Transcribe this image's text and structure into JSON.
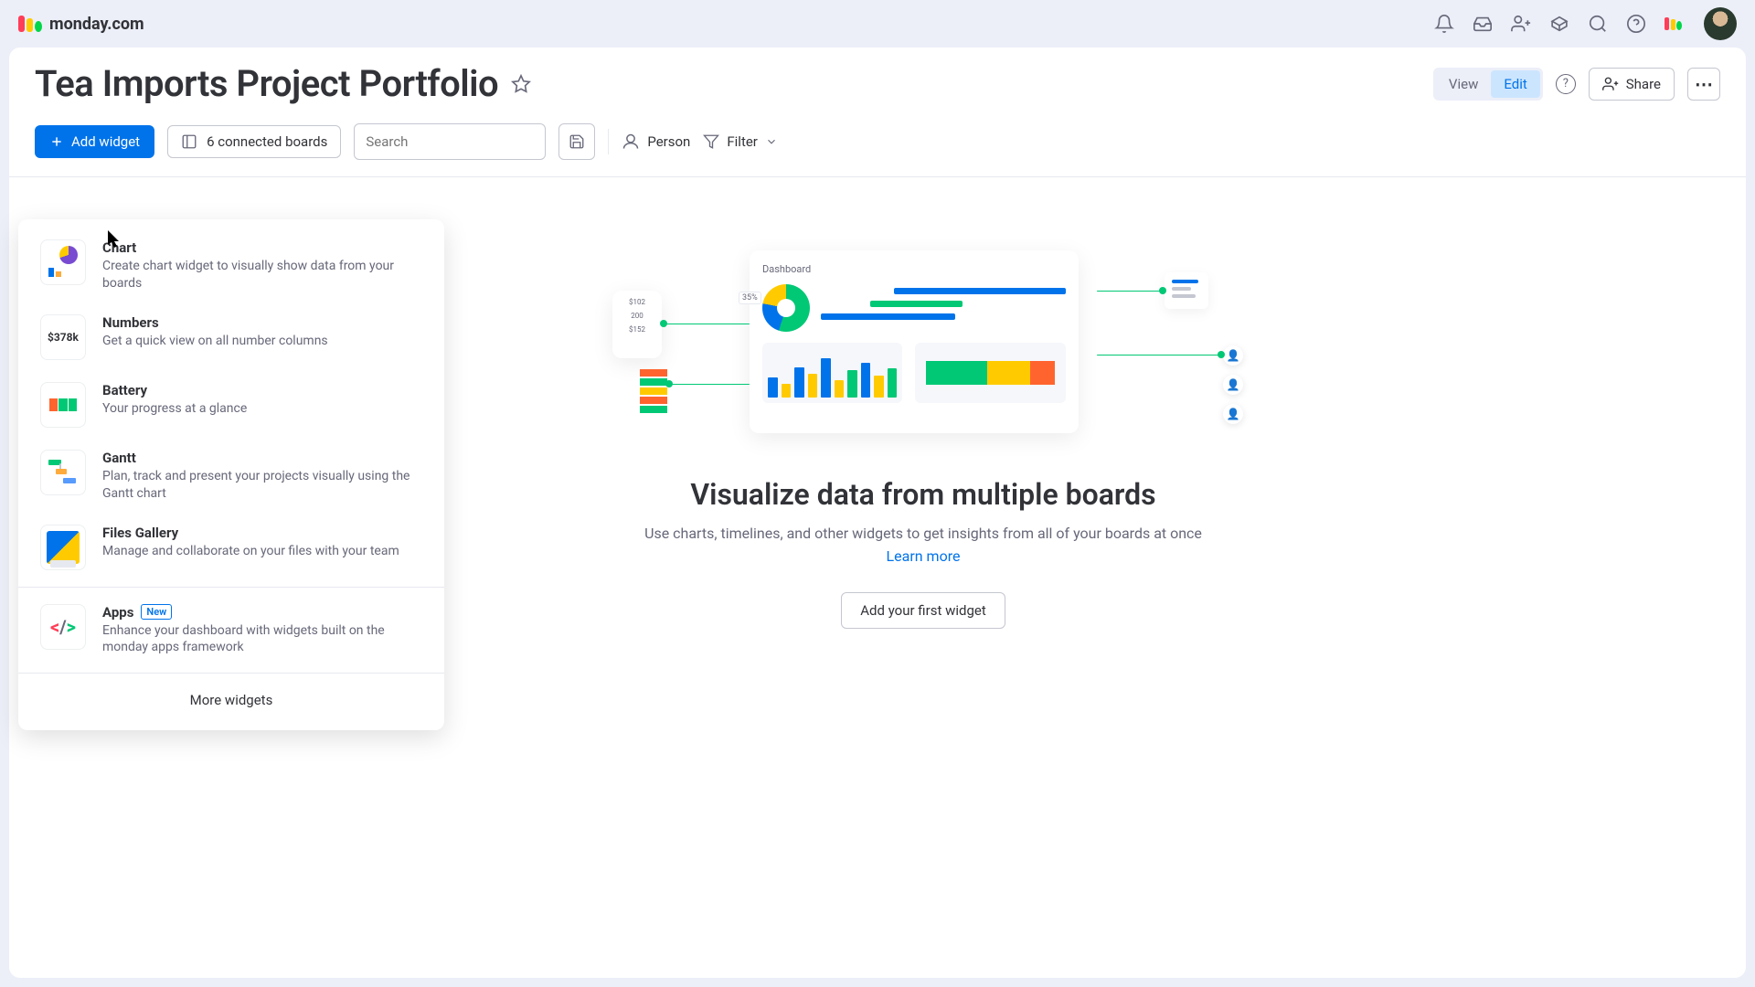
{
  "brand": "monday.com",
  "page_title": "Tea Imports Project Portfolio",
  "mode": {
    "view": "View",
    "edit": "Edit"
  },
  "header_actions": {
    "share": "Share"
  },
  "toolbar": {
    "add_widget": "Add widget",
    "connected_boards": "6 connected boards",
    "search_placeholder": "Search",
    "person": "Person",
    "filter": "Filter"
  },
  "widget_menu": {
    "items": [
      {
        "name": "Chart",
        "desc": "Create chart widget to visually show data from your boards"
      },
      {
        "name": "Numbers",
        "desc": "Get a quick view on all number columns",
        "thumb_text": "$378k"
      },
      {
        "name": "Battery",
        "desc": "Your progress at a glance"
      },
      {
        "name": "Gantt",
        "desc": "Plan, track and present your projects visually using the Gantt chart"
      },
      {
        "name": "Files Gallery",
        "desc": "Manage and collaborate on your files with your team"
      },
      {
        "name": "Apps",
        "desc": "Enhance your dashboard with widgets built on the monday apps framework",
        "badge": "New"
      }
    ],
    "more": "More widgets"
  },
  "empty_state": {
    "dashboard_label": "Dashboard",
    "pie_pct": "35%",
    "left_numbers": [
      "$102",
      "200",
      "$152"
    ],
    "title": "Visualize data from multiple boards",
    "subtitle": "Use charts, timelines, and other widgets to get insights from all of your boards at once",
    "learn_more": "Learn more",
    "cta": "Add your first widget"
  }
}
